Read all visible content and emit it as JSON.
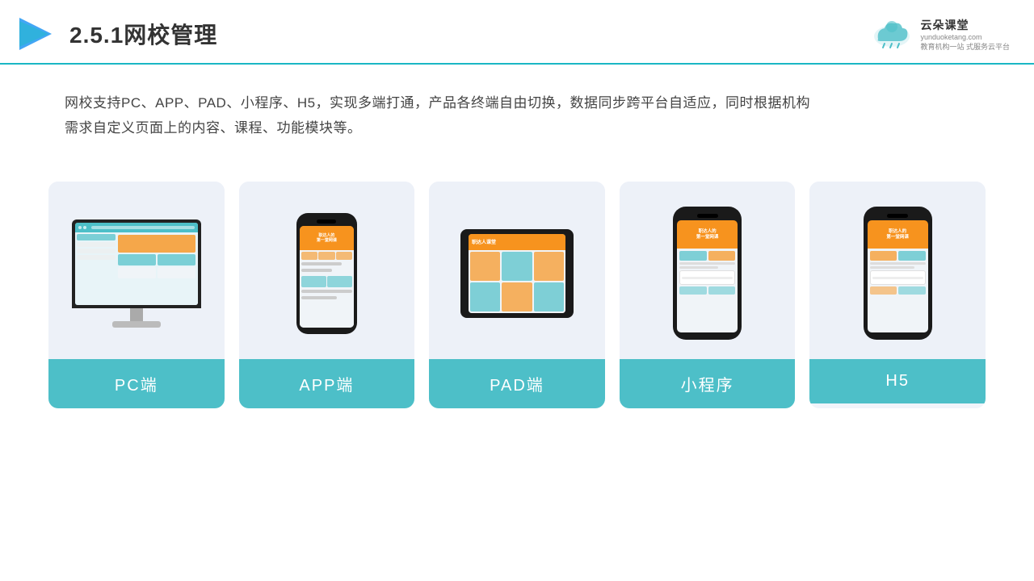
{
  "header": {
    "title": "2.5.1网校管理",
    "brand_name": "云朵课堂",
    "brand_url": "yunduoketang.com",
    "brand_slogan_line1": "教育机构一站",
    "brand_slogan_line2": "式服务云平台"
  },
  "description": {
    "text_line1": "网校支持PC、APP、PAD、小程序、H5，实现多端打通，产品各终端自由切换，数据同步跨平台自适应，同时根据机构",
    "text_line2": "需求自定义页面上的内容、课程、功能模块等。"
  },
  "cards": [
    {
      "id": "pc",
      "label": "PC端",
      "device_type": "monitor"
    },
    {
      "id": "app",
      "label": "APP端",
      "device_type": "phone"
    },
    {
      "id": "pad",
      "label": "PAD端",
      "device_type": "tablet"
    },
    {
      "id": "miniprogram",
      "label": "小程序",
      "device_type": "phone_small"
    },
    {
      "id": "h5",
      "label": "H5",
      "device_type": "phone_small2"
    }
  ],
  "colors": {
    "teal": "#4dbfc8",
    "orange": "#f7931e",
    "bg_card": "#edf1f8",
    "label_bg": "#4dbfc8"
  }
}
